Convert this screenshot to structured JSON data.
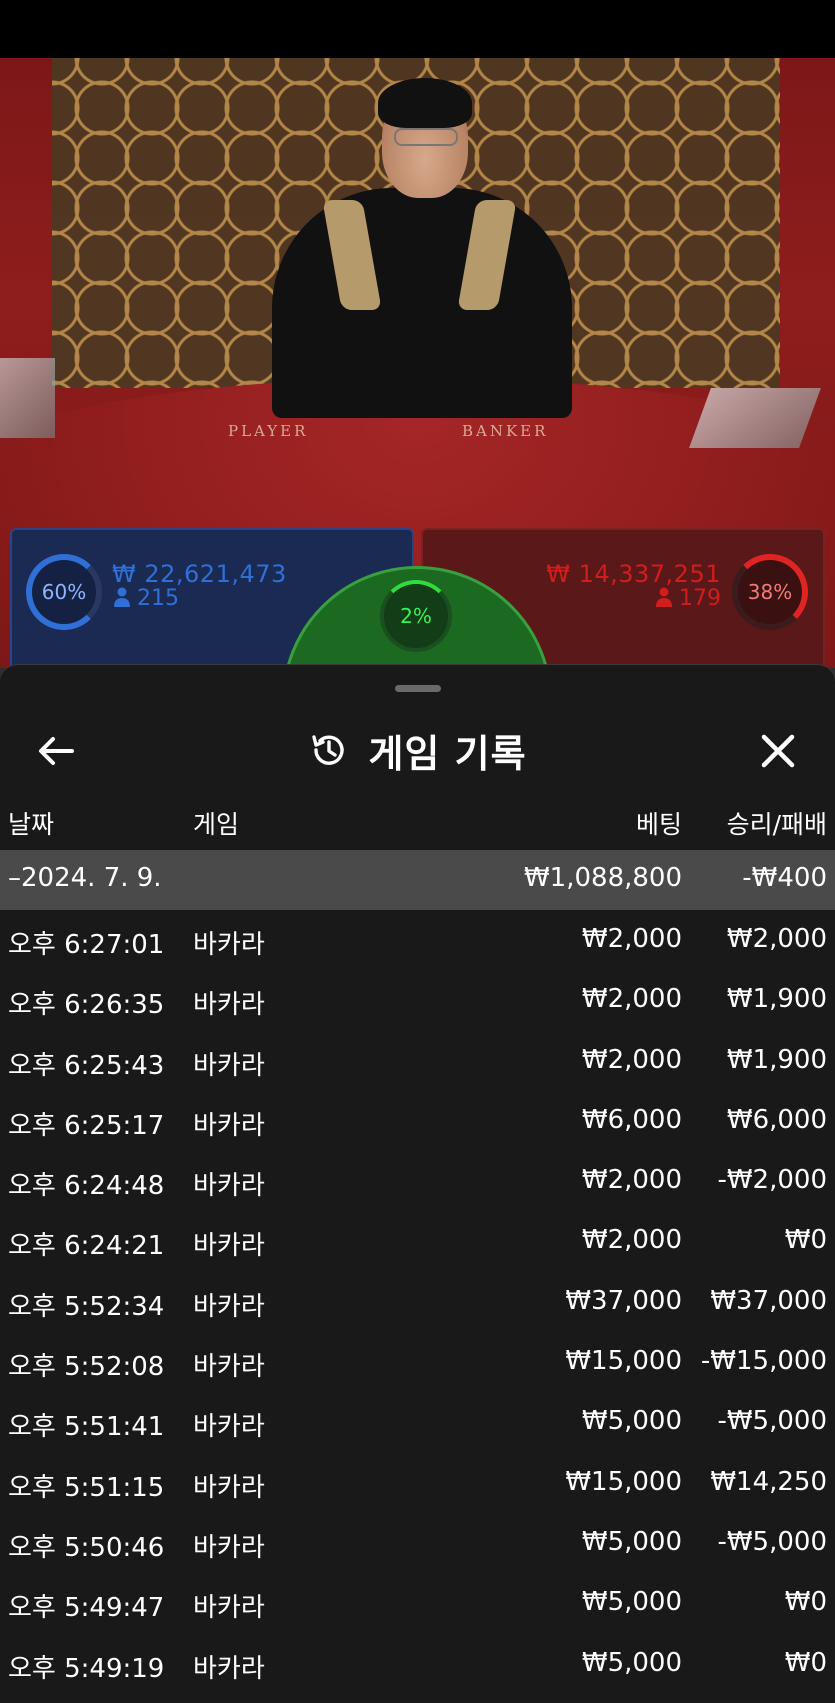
{
  "video": {
    "label_player": "PLAYER",
    "label_banker": "BANKER"
  },
  "bets": {
    "player": {
      "percent": "60%",
      "amount": "₩ 22,621,473",
      "players": "215"
    },
    "tie": {
      "percent": "2%"
    },
    "banker": {
      "percent": "38%",
      "amount": "₩ 14,337,251",
      "players": "179"
    },
    "colors": {
      "player": "#2f6fd6",
      "banker": "#e02424",
      "tie": "#2fdc3a"
    }
  },
  "history": {
    "title": "게임 기록",
    "columns": {
      "date": "날짜",
      "game": "게임",
      "bet": "베팅",
      "result": "승리/패배"
    },
    "summary": {
      "date": "–2024. 7. 9.",
      "bet": "₩1,088,800",
      "result": "-₩400"
    },
    "rows": [
      {
        "time": "오후 6:27:01",
        "game": "바카라",
        "bet": "₩2,000",
        "result": "₩2,000"
      },
      {
        "time": "오후 6:26:35",
        "game": "바카라",
        "bet": "₩2,000",
        "result": "₩1,900"
      },
      {
        "time": "오후 6:25:43",
        "game": "바카라",
        "bet": "₩2,000",
        "result": "₩1,900"
      },
      {
        "time": "오후 6:25:17",
        "game": "바카라",
        "bet": "₩6,000",
        "result": "₩6,000"
      },
      {
        "time": "오후 6:24:48",
        "game": "바카라",
        "bet": "₩2,000",
        "result": "-₩2,000"
      },
      {
        "time": "오후 6:24:21",
        "game": "바카라",
        "bet": "₩2,000",
        "result": "₩0"
      },
      {
        "time": "오후 5:52:34",
        "game": "바카라",
        "bet": "₩37,000",
        "result": "₩37,000"
      },
      {
        "time": "오후 5:52:08",
        "game": "바카라",
        "bet": "₩15,000",
        "result": "-₩15,000"
      },
      {
        "time": "오후 5:51:41",
        "game": "바카라",
        "bet": "₩5,000",
        "result": "-₩5,000"
      },
      {
        "time": "오후 5:51:15",
        "game": "바카라",
        "bet": "₩15,000",
        "result": "₩14,250"
      },
      {
        "time": "오후 5:50:46",
        "game": "바카라",
        "bet": "₩5,000",
        "result": "-₩5,000"
      },
      {
        "time": "오후 5:49:47",
        "game": "바카라",
        "bet": "₩5,000",
        "result": "₩0"
      },
      {
        "time": "오후 5:49:19",
        "game": "바카라",
        "bet": "₩5,000",
        "result": "₩0"
      }
    ]
  },
  "icons": {
    "back": "arrow-left-icon",
    "history": "history-clock-icon",
    "close": "close-icon",
    "person": "person-icon"
  }
}
